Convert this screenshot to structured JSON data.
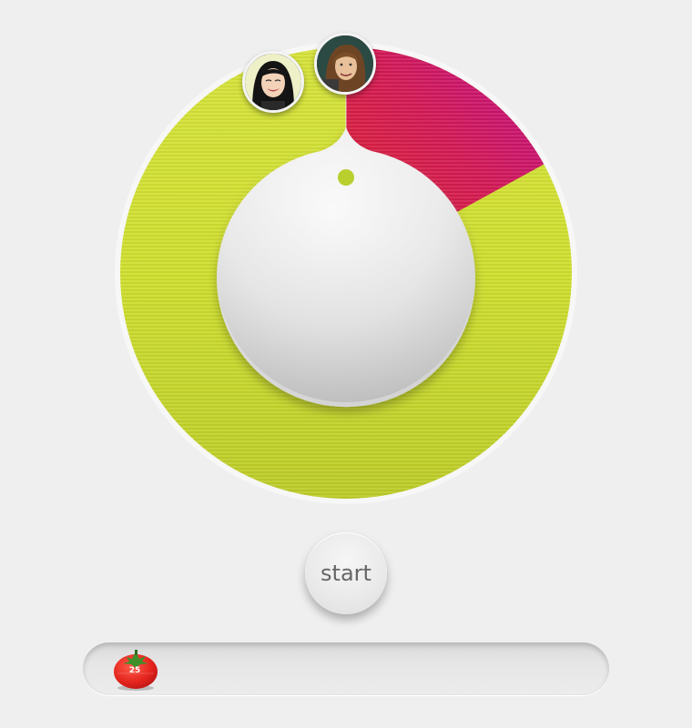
{
  "timer": {
    "start_label": "start",
    "tray_tomato_minutes": "25",
    "ring_colors": {
      "rest": "#c6d830",
      "active_start": "#e0262a",
      "active_end": "#c0108e",
      "knob_dot": "#b9cf2e"
    },
    "active_segment_fraction": 0.17
  },
  "users": [
    {
      "name": "user-avatar-woman-smiling",
      "icon": "avatar"
    },
    {
      "name": "user-avatar-woman-brown-hair",
      "icon": "avatar"
    }
  ]
}
